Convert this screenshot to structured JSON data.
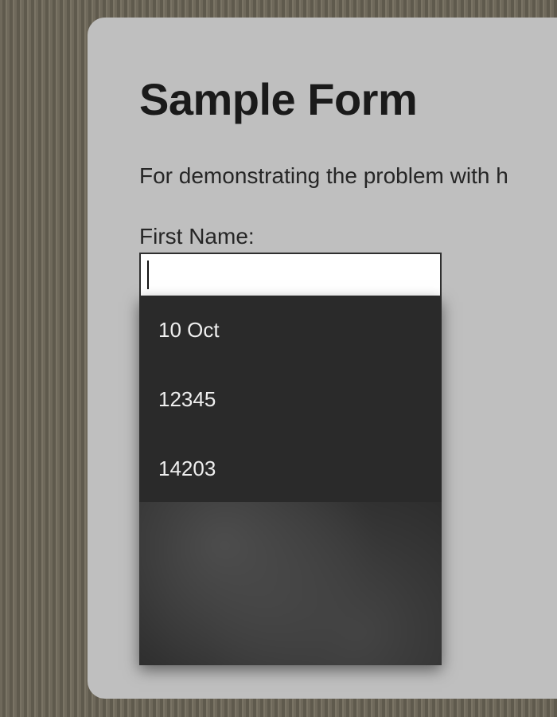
{
  "form": {
    "title": "Sample Form",
    "description": "For demonstrating the problem with h",
    "first_name_label": "First Name:",
    "first_name_value": ""
  },
  "autocomplete": {
    "items": [
      "10 Oct",
      "12345",
      "14203"
    ]
  }
}
